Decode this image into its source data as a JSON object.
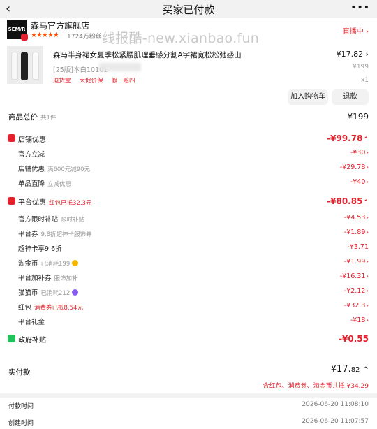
{
  "header": {
    "back_icon": "‹",
    "title": "买家已付款",
    "more_icon": "•••"
  },
  "shop": {
    "logo_text": "SEM/R",
    "name": "森马官方旗舰店",
    "stars": "★★★★★",
    "fans": "1724万粉丝",
    "live": "直播中 ›"
  },
  "watermark": "线报酷-new.xianbao.fun",
  "product": {
    "title": "森马半身裙女夏季松紧腰肌理垂感分割A字裙宽松松弛感山",
    "sku": "[25版]本白10101",
    "tags": [
      "退货宝",
      "大促价保",
      "假一赔四"
    ],
    "price": "¥17.82",
    "price_arrow": "›",
    "original_price": "¥199",
    "quantity": "x1",
    "add_cart_label": "加入购物车",
    "refund_label": "退款"
  },
  "summary": {
    "total": {
      "label": "商品总价",
      "sub": "共1件",
      "value": "¥199"
    },
    "shop_discount": {
      "label": "店铺优惠",
      "value": "-¥99.78",
      "arrow": "^",
      "items": [
        {
          "label": "官方立减",
          "sub": "",
          "value": "-¥30"
        },
        {
          "label": "店铺优惠",
          "sub": "满600元减90元",
          "value": "-¥29.78"
        },
        {
          "label": "单品直降",
          "sub": "立减优惠",
          "value": "-¥40"
        }
      ]
    },
    "platform_discount": {
      "label": "平台优惠",
      "sub": "红包已抵32.3元",
      "value": "-¥80.85",
      "arrow": "^",
      "items": [
        {
          "label": "官方限时补贴",
          "sub": "限时补贴",
          "value": "-¥4.53"
        },
        {
          "label": "平台券",
          "sub": "9.8折超神卡服饰券",
          "value": "-¥1.89"
        },
        {
          "label": "超神卡享9.6折",
          "sub": "",
          "value": "-¥3.71"
        },
        {
          "label": "淘金币",
          "sub": "已消耗199",
          "value": "-¥1.99"
        },
        {
          "label": "平台加补券",
          "sub": "服饰加补",
          "value": "-¥16.31"
        },
        {
          "label": "猫猫币",
          "sub": "已消耗212",
          "value": "-¥2.12"
        },
        {
          "label": "红包",
          "sub": "消费券已抵8.54元",
          "value": "-¥32.3"
        },
        {
          "label": "平台礼金",
          "sub": "",
          "value": "-¥18"
        }
      ]
    },
    "gov_subsidy": {
      "label": "政府补贴",
      "value": "-¥0.55"
    }
  },
  "payment": {
    "label": "实付款",
    "amount_int": "¥17.",
    "amount_dec": "82",
    "arrow": "^",
    "note": "含红包、消费券、淘金币共抵 ¥34.29"
  },
  "times": [
    {
      "label": "付款时间",
      "value": "2026-06-20 11:08:10"
    },
    {
      "label": "创建时间",
      "value": "2026-06-20 11:07:57"
    }
  ],
  "colors": {
    "accent_red": "#e3202b",
    "orange": "#ff5000",
    "green": "#21c15b",
    "background": "#f2f2f2"
  }
}
